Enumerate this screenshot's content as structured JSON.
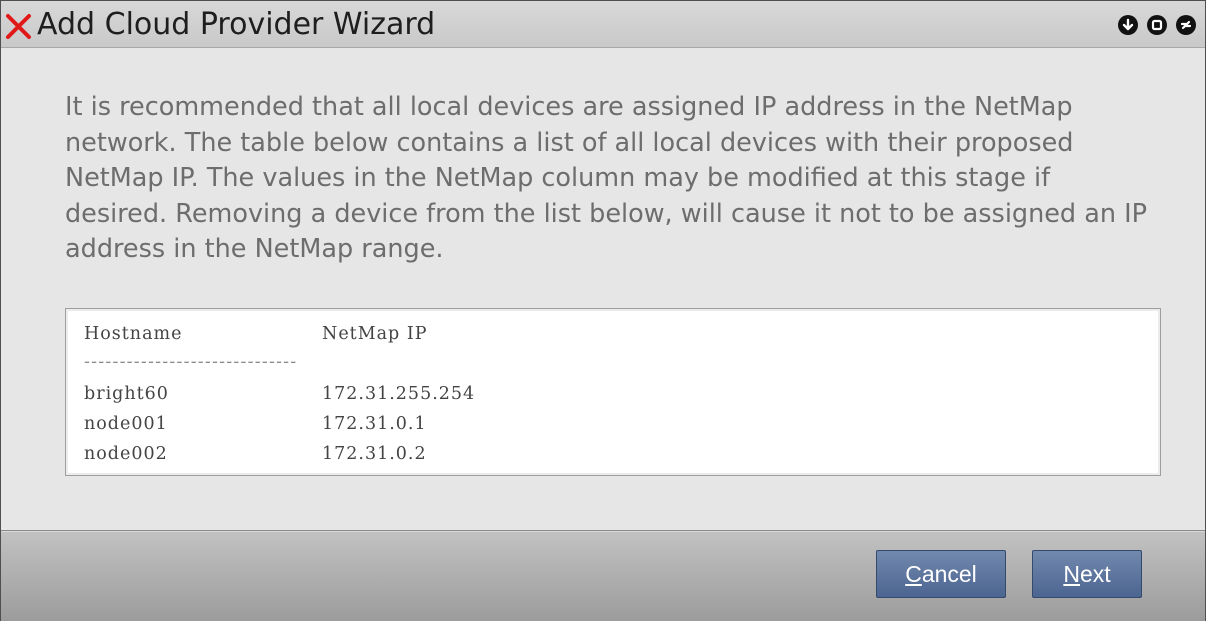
{
  "window": {
    "title": "Add Cloud Provider Wizard",
    "controls": [
      "minimize-icon",
      "maximize-icon",
      "close-icon"
    ]
  },
  "description": "It is recommended that all local devices are assigned IP address in the NetMap network. The table below contains a list of all local devices with their proposed NetMap IP. The values in the NetMap column may be modified at this stage if desired. Removing a device from the list below, will cause it not to be assigned an IP address in the NetMap range.",
  "table": {
    "headers": [
      "Hostname",
      "NetMap IP"
    ],
    "separator": "------------------------------",
    "rows": [
      [
        "bright60",
        "172.31.255.254"
      ],
      [
        "node001",
        "172.31.0.1"
      ],
      [
        "node002",
        "172.31.0.2"
      ]
    ]
  },
  "buttons": {
    "cancel": {
      "accel": "C",
      "rest": "ancel"
    },
    "next": {
      "accel": "N",
      "rest": "ext"
    }
  },
  "colors": {
    "title_x": "#e01818",
    "button": "#5a72a0"
  }
}
